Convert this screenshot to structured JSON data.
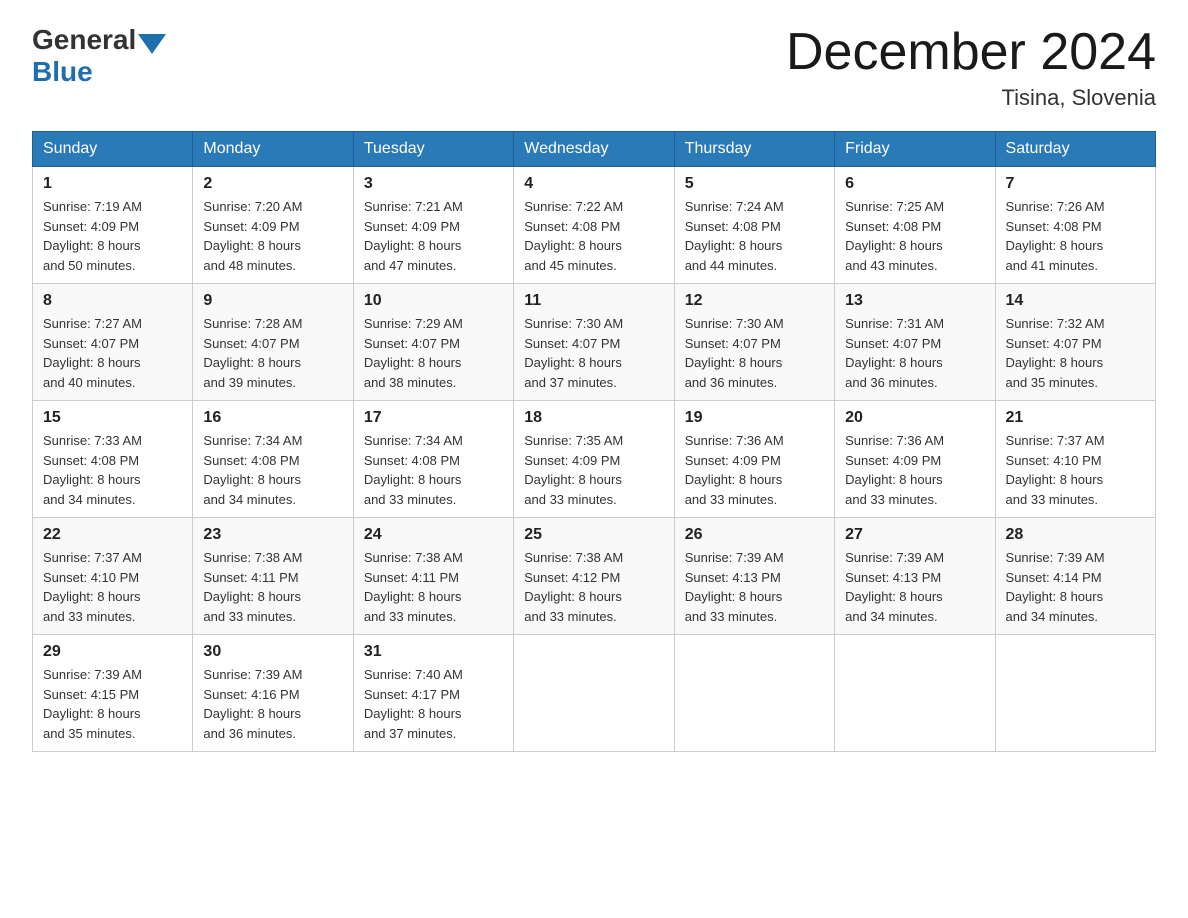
{
  "header": {
    "logo_general": "General",
    "logo_blue": "Blue",
    "month_title": "December 2024",
    "location": "Tisina, Slovenia"
  },
  "weekdays": [
    "Sunday",
    "Monday",
    "Tuesday",
    "Wednesday",
    "Thursday",
    "Friday",
    "Saturday"
  ],
  "weeks": [
    [
      {
        "day": "1",
        "sunrise": "7:19 AM",
        "sunset": "4:09 PM",
        "daylight": "8 hours and 50 minutes."
      },
      {
        "day": "2",
        "sunrise": "7:20 AM",
        "sunset": "4:09 PM",
        "daylight": "8 hours and 48 minutes."
      },
      {
        "day": "3",
        "sunrise": "7:21 AM",
        "sunset": "4:09 PM",
        "daylight": "8 hours and 47 minutes."
      },
      {
        "day": "4",
        "sunrise": "7:22 AM",
        "sunset": "4:08 PM",
        "daylight": "8 hours and 45 minutes."
      },
      {
        "day": "5",
        "sunrise": "7:24 AM",
        "sunset": "4:08 PM",
        "daylight": "8 hours and 44 minutes."
      },
      {
        "day": "6",
        "sunrise": "7:25 AM",
        "sunset": "4:08 PM",
        "daylight": "8 hours and 43 minutes."
      },
      {
        "day": "7",
        "sunrise": "7:26 AM",
        "sunset": "4:08 PM",
        "daylight": "8 hours and 41 minutes."
      }
    ],
    [
      {
        "day": "8",
        "sunrise": "7:27 AM",
        "sunset": "4:07 PM",
        "daylight": "8 hours and 40 minutes."
      },
      {
        "day": "9",
        "sunrise": "7:28 AM",
        "sunset": "4:07 PM",
        "daylight": "8 hours and 39 minutes."
      },
      {
        "day": "10",
        "sunrise": "7:29 AM",
        "sunset": "4:07 PM",
        "daylight": "8 hours and 38 minutes."
      },
      {
        "day": "11",
        "sunrise": "7:30 AM",
        "sunset": "4:07 PM",
        "daylight": "8 hours and 37 minutes."
      },
      {
        "day": "12",
        "sunrise": "7:30 AM",
        "sunset": "4:07 PM",
        "daylight": "8 hours and 36 minutes."
      },
      {
        "day": "13",
        "sunrise": "7:31 AM",
        "sunset": "4:07 PM",
        "daylight": "8 hours and 36 minutes."
      },
      {
        "day": "14",
        "sunrise": "7:32 AM",
        "sunset": "4:07 PM",
        "daylight": "8 hours and 35 minutes."
      }
    ],
    [
      {
        "day": "15",
        "sunrise": "7:33 AM",
        "sunset": "4:08 PM",
        "daylight": "8 hours and 34 minutes."
      },
      {
        "day": "16",
        "sunrise": "7:34 AM",
        "sunset": "4:08 PM",
        "daylight": "8 hours and 34 minutes."
      },
      {
        "day": "17",
        "sunrise": "7:34 AM",
        "sunset": "4:08 PM",
        "daylight": "8 hours and 33 minutes."
      },
      {
        "day": "18",
        "sunrise": "7:35 AM",
        "sunset": "4:09 PM",
        "daylight": "8 hours and 33 minutes."
      },
      {
        "day": "19",
        "sunrise": "7:36 AM",
        "sunset": "4:09 PM",
        "daylight": "8 hours and 33 minutes."
      },
      {
        "day": "20",
        "sunrise": "7:36 AM",
        "sunset": "4:09 PM",
        "daylight": "8 hours and 33 minutes."
      },
      {
        "day": "21",
        "sunrise": "7:37 AM",
        "sunset": "4:10 PM",
        "daylight": "8 hours and 33 minutes."
      }
    ],
    [
      {
        "day": "22",
        "sunrise": "7:37 AM",
        "sunset": "4:10 PM",
        "daylight": "8 hours and 33 minutes."
      },
      {
        "day": "23",
        "sunrise": "7:38 AM",
        "sunset": "4:11 PM",
        "daylight": "8 hours and 33 minutes."
      },
      {
        "day": "24",
        "sunrise": "7:38 AM",
        "sunset": "4:11 PM",
        "daylight": "8 hours and 33 minutes."
      },
      {
        "day": "25",
        "sunrise": "7:38 AM",
        "sunset": "4:12 PM",
        "daylight": "8 hours and 33 minutes."
      },
      {
        "day": "26",
        "sunrise": "7:39 AM",
        "sunset": "4:13 PM",
        "daylight": "8 hours and 33 minutes."
      },
      {
        "day": "27",
        "sunrise": "7:39 AM",
        "sunset": "4:13 PM",
        "daylight": "8 hours and 34 minutes."
      },
      {
        "day": "28",
        "sunrise": "7:39 AM",
        "sunset": "4:14 PM",
        "daylight": "8 hours and 34 minutes."
      }
    ],
    [
      {
        "day": "29",
        "sunrise": "7:39 AM",
        "sunset": "4:15 PM",
        "daylight": "8 hours and 35 minutes."
      },
      {
        "day": "30",
        "sunrise": "7:39 AM",
        "sunset": "4:16 PM",
        "daylight": "8 hours and 36 minutes."
      },
      {
        "day": "31",
        "sunrise": "7:40 AM",
        "sunset": "4:17 PM",
        "daylight": "8 hours and 37 minutes."
      },
      null,
      null,
      null,
      null
    ]
  ],
  "labels": {
    "sunrise": "Sunrise:",
    "sunset": "Sunset:",
    "daylight": "Daylight:"
  }
}
